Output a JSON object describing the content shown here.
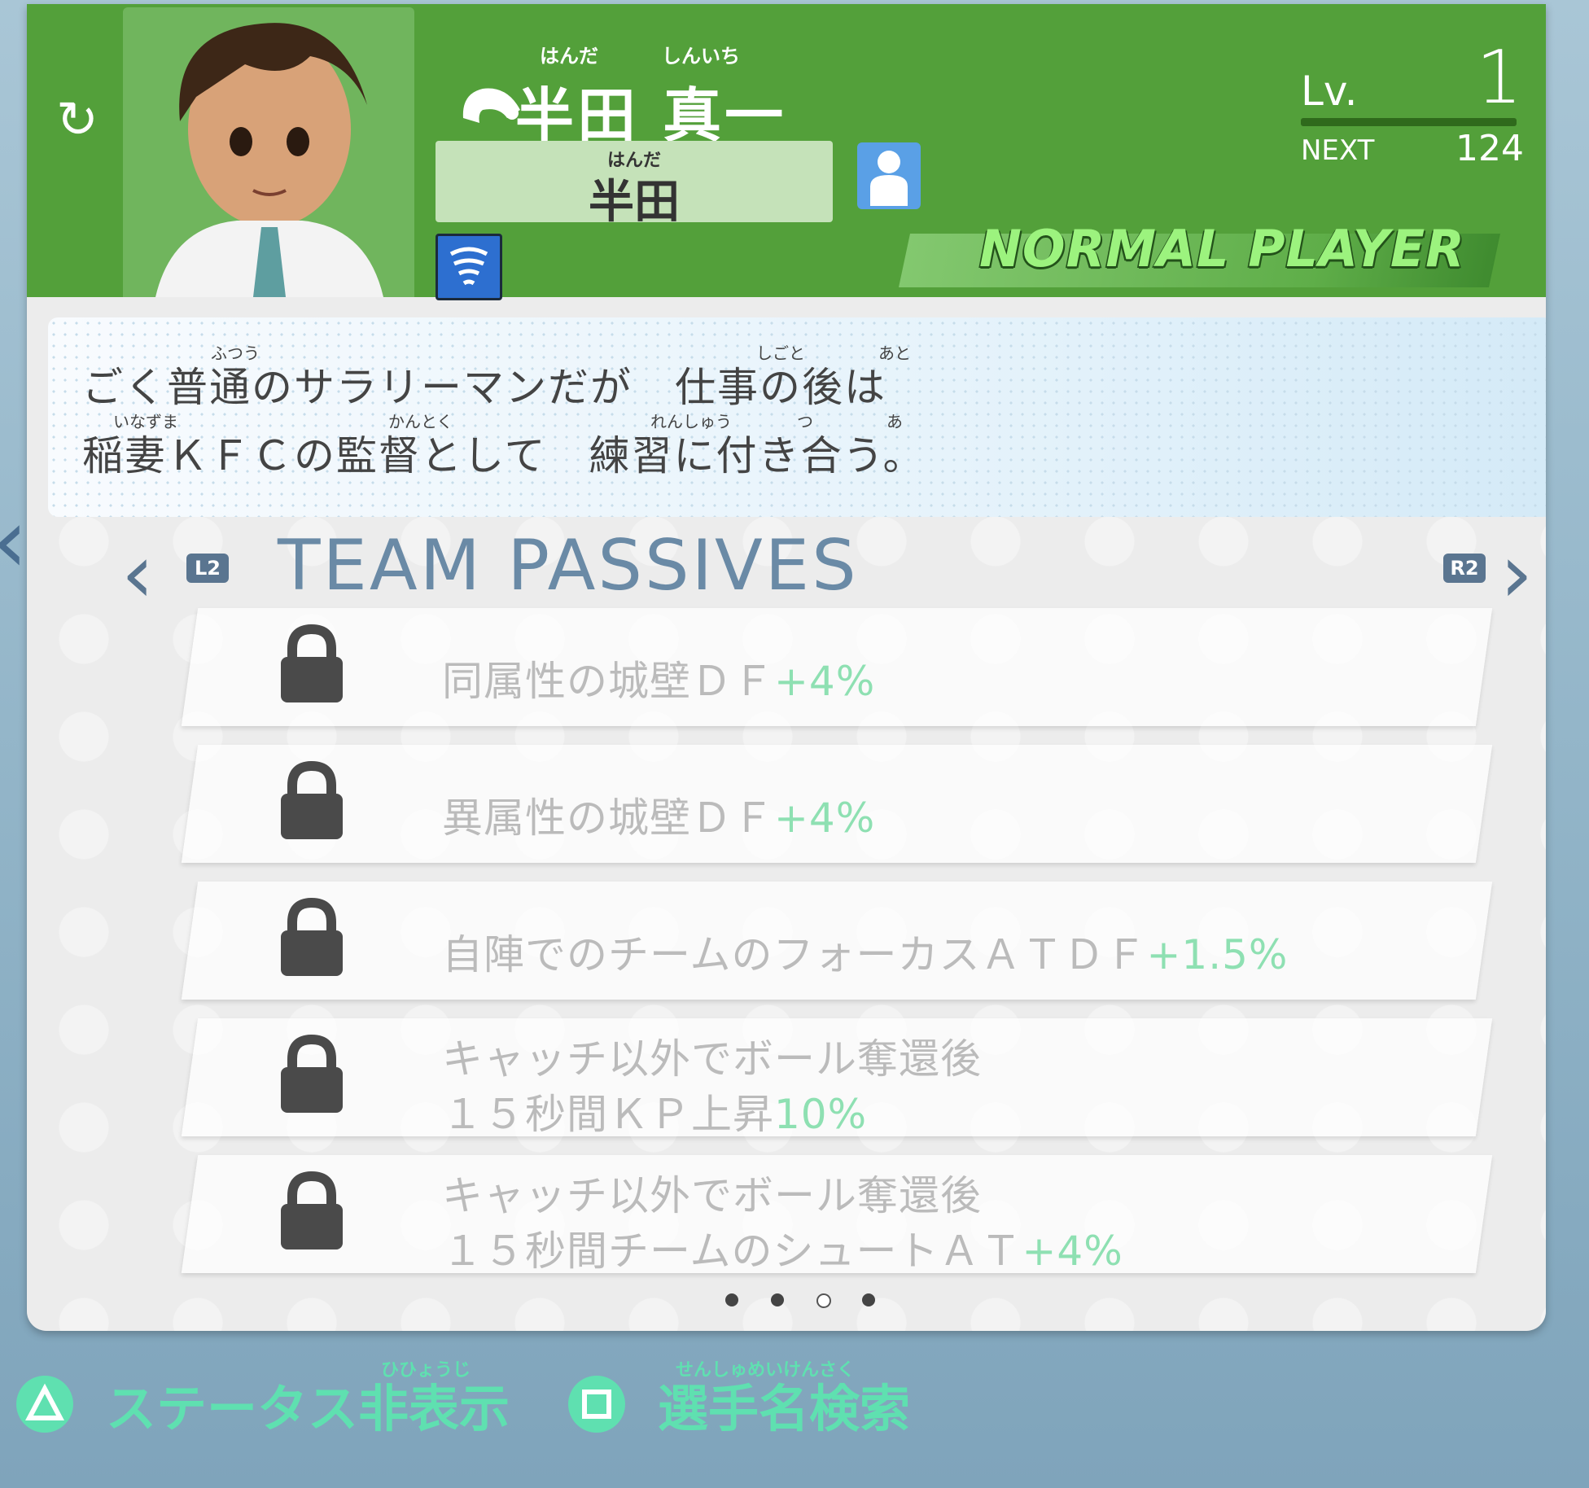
{
  "header": {
    "player_name": "半田 真一",
    "player_name_ruby": [
      "はんだ",
      "しんいち"
    ],
    "nickname": "半田",
    "nickname_ruby": "はんだ",
    "level_label": "Lv.",
    "level_value": "1",
    "next_label": "NEXT",
    "next_value": "124",
    "rarity": "NORMAL PLAYER",
    "accent_color": "#53a03a",
    "element_icon": "wind-icon",
    "position_icon": "person-icon",
    "style_icon": "tornado-icon"
  },
  "description": {
    "line1": "ごく普通のサラリーマンだが　仕事の後は",
    "line2": "稲妻ＫＦＣの監督として　練習に付き合う。",
    "ruby": [
      "ふつう",
      "しごと",
      "あと",
      "いなずま",
      "かんとく",
      "れんしゅう",
      "つ",
      "あ"
    ]
  },
  "team_passives": {
    "title": "TEAM PASSIVES",
    "left_button": "L2",
    "right_button": "R2",
    "items": [
      {
        "text": "同属性の城壁ＤＦ",
        "value": "+4%",
        "locked": true
      },
      {
        "text": "異属性の城壁ＤＦ",
        "value": "+4%",
        "locked": true
      },
      {
        "text": "自陣でのチームのフォーカスＡＴＤＦ",
        "value": "+1.5%",
        "locked": true
      },
      {
        "text": "キャッチ以外でボール奪還後",
        "text2": "１５秒間ＫＰ上昇",
        "value": "10%",
        "locked": true
      },
      {
        "text": "キャッチ以外でボール奪還後",
        "text2": "１５秒間チームのシュートＡＴ",
        "value": "+4%",
        "locked": true
      }
    ],
    "page_count": 4,
    "active_page": 3
  },
  "footer": {
    "hide_status": "ステータス非表示",
    "hide_status_ruby": "ひひょうじ",
    "search_player": "選手名検索",
    "search_player_ruby": "せんしゅめいけんさく",
    "triangle_icon": "triangle-button-icon",
    "square_icon": "square-button-icon"
  }
}
